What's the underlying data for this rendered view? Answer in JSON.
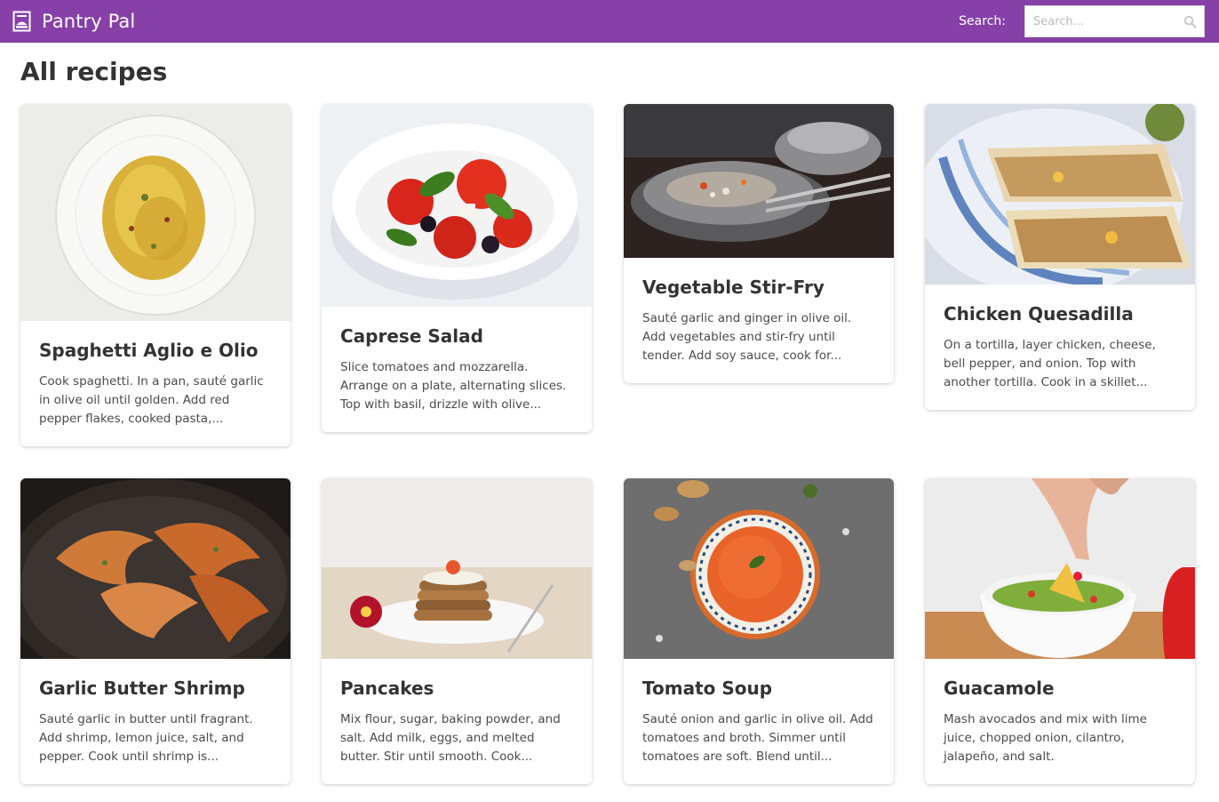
{
  "app": {
    "name": "Pantry Pal",
    "accent": "#8640a8"
  },
  "search": {
    "label": "Search:",
    "placeholder": "Search..."
  },
  "page": {
    "title": "All recipes"
  },
  "recipes": [
    {
      "title": "Spaghetti Aglio e Olio",
      "excerpt": "Cook spaghetti. In a pan, sauté garlic in olive oil until golden. Add red pepper flakes, cooked pasta,..."
    },
    {
      "title": "Caprese Salad",
      "excerpt": "Slice tomatoes and mozzarella. Arrange on a plate, alternating slices. Top with basil, drizzle with olive..."
    },
    {
      "title": "Vegetable Stir-Fry",
      "excerpt": "Sauté garlic and ginger in olive oil. Add vegetables and stir-fry until tender. Add soy sauce, cook for..."
    },
    {
      "title": "Chicken Quesadilla",
      "excerpt": "On a tortilla, layer chicken, cheese, bell pepper, and onion. Top with another tortilla. Cook in a skillet..."
    },
    {
      "title": "Garlic Butter Shrimp",
      "excerpt": "Sauté garlic in butter until fragrant. Add shrimp, lemon juice, salt, and pepper. Cook until shrimp is..."
    },
    {
      "title": "Pancakes",
      "excerpt": "Mix flour, sugar, baking powder, and salt. Add milk, eggs, and melted butter. Stir until smooth. Cook..."
    },
    {
      "title": "Tomato Soup",
      "excerpt": "Sauté onion and garlic in olive oil. Add tomatoes and broth. Simmer until tomatoes are soft. Blend until..."
    },
    {
      "title": "Guacamole",
      "excerpt": "Mash avocados and mix with lime juice, chopped onion, cilantro, jalapeño, and salt."
    }
  ]
}
